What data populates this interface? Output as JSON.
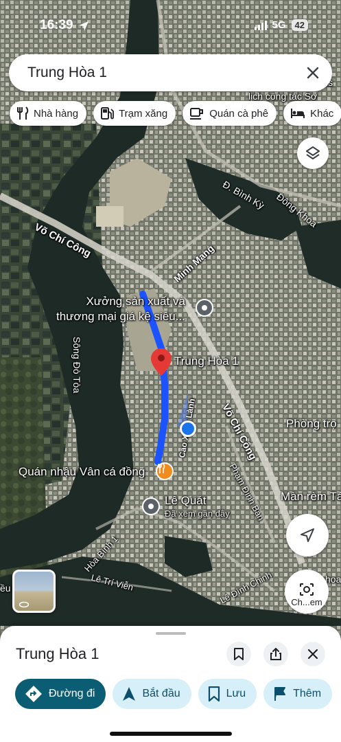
{
  "status_bar": {
    "time": "16:39",
    "network": "5G",
    "battery": "42"
  },
  "search": {
    "query": "Trung Hòa 1",
    "clear_icon": "close-icon"
  },
  "chips": [
    {
      "label": "Nhà hàng",
      "icon": "restaurant-icon"
    },
    {
      "label": "Trạm xăng",
      "icon": "gas-station-icon"
    },
    {
      "label": "Quán cà phê",
      "icon": "coffee-icon"
    },
    {
      "label": "Khác",
      "icon": "hotel-icon"
    }
  ],
  "map": {
    "roads": {
      "vo_chi_cong_west": "Võ Chí Công",
      "vo_chi_cong_east": "Võ Chí Công",
      "minh_mang": "Minh Mạng",
      "binh_ky": "Đ. Bình Kỳ",
      "dong_khoa": "Đông Khoa",
      "cao_lanh": "Cao Xuân Lành",
      "pham_dinh_ban": "Phạm Đình Bản",
      "hoa_binh_1": "Hòa Bình 1",
      "le_tri_vien": "Lê Trí Viễn",
      "le_dinh_chinh": "Lê Đình Chinh",
      "song_do_toa": "Sông Đò Tòa",
      "lich_cong_tac": "lịch công tác Sơ",
      "vis": "vis",
      "eu": "ều",
      "hoa": "hoa"
    },
    "places": {
      "factory": "Xưởng sản xuất và\nthương mại giá kệ siêu...",
      "destination": "Trung Hòa 1",
      "restaurant": "Quán nhậu Vân cá đồng",
      "le_quat": "Lê Quát",
      "le_quat_sub": "Đã xem gần đây",
      "phong_tro": "Phòng trọ",
      "man_rem": "Màn rèm Tá"
    },
    "streetview_label": "Ch...em",
    "route_color": "#1a53ff",
    "pin_color": "#e53935"
  },
  "sheet": {
    "title": "Trung Hòa 1",
    "actions": [
      {
        "label": "Đường đi",
        "icon": "directions-icon",
        "primary": true
      },
      {
        "label": "Bắt đầu",
        "icon": "navigation-arrow-icon",
        "primary": false
      },
      {
        "label": "Lưu",
        "icon": "bookmark-icon",
        "primary": false
      },
      {
        "label": "Thêm",
        "icon": "flag-icon",
        "primary": false
      }
    ]
  }
}
